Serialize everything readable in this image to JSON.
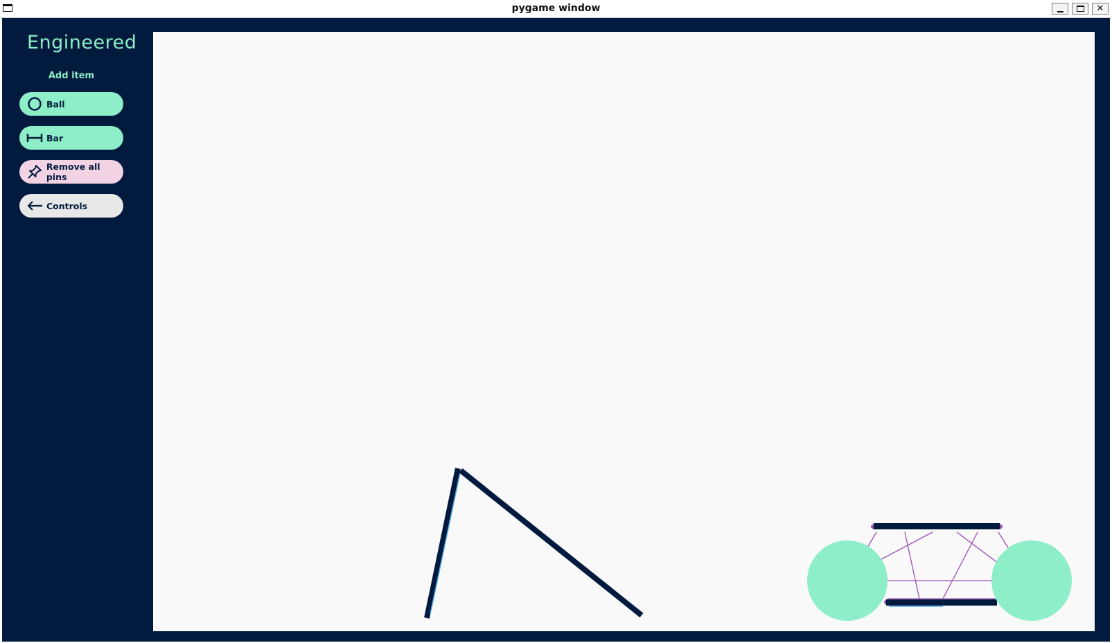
{
  "window": {
    "title": "pygame window",
    "controls": {
      "minimize_icon": "minimize-icon",
      "maximize_icon": "maximize-icon",
      "close_glyph": "✕"
    }
  },
  "sidebar": {
    "logo": "Engineered",
    "section_label": "Add item",
    "buttons": [
      {
        "label": "Ball",
        "icon": "circle-icon",
        "color": "#8deec8"
      },
      {
        "label": "Bar",
        "icon": "bar-icon",
        "color": "#8deec8"
      },
      {
        "label": "Remove all pins",
        "icon": "pin-icon",
        "color": "#f2d3e4"
      },
      {
        "label": "Controls",
        "icon": "arrow-left-icon",
        "color": "#e8e8e8"
      }
    ]
  },
  "colors": {
    "app_background": "#011a3d",
    "accent": "#8deec8",
    "canvas": "#f9f9f9",
    "pin_line": "#9b4fb8",
    "bar": "#011a3d"
  }
}
